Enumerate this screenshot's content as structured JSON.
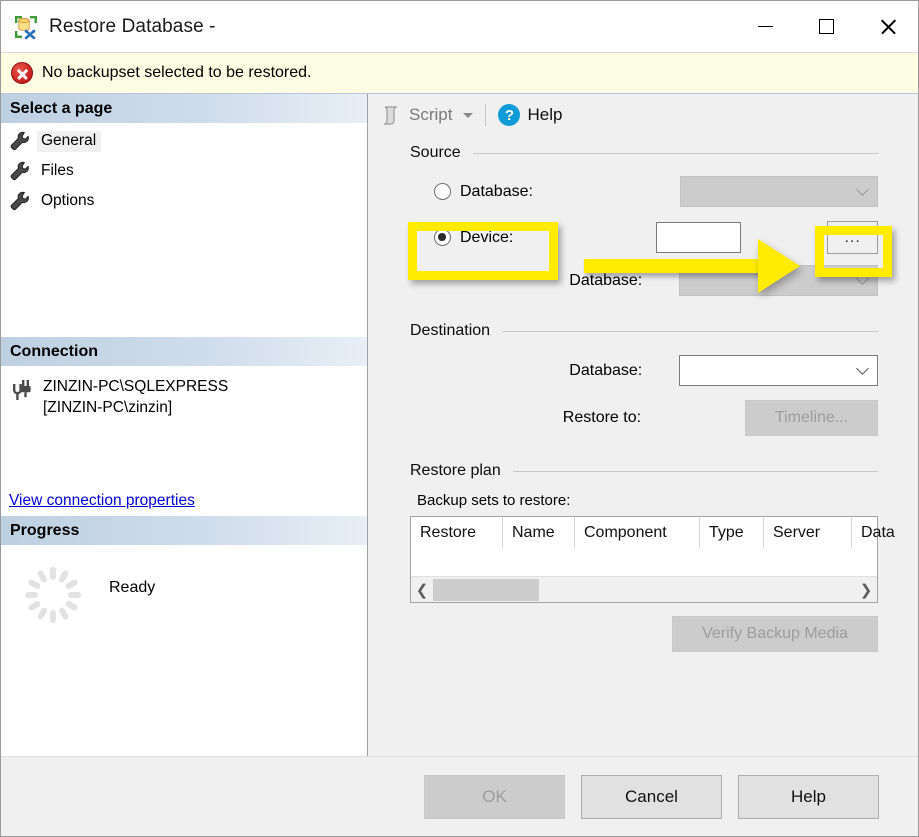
{
  "window": {
    "title": "Restore Database -",
    "icon": "restore-database-icon",
    "minimize_label": "Minimize",
    "maximize_label": "Maximize",
    "close_label": "Close"
  },
  "error_bar": {
    "icon": "error-x-icon",
    "message": "No backupset selected to be restored."
  },
  "left_panel": {
    "pages_header": "Select a page",
    "pages": [
      {
        "label": "General",
        "icon": "wrench-icon",
        "selected": true
      },
      {
        "label": "Files",
        "icon": "wrench-icon",
        "selected": false
      },
      {
        "label": "Options",
        "icon": "wrench-icon",
        "selected": false
      }
    ],
    "connection_header": "Connection",
    "connection_icon": "plug-connection-icon",
    "connection_server": "ZINZIN-PC\\SQLEXPRESS",
    "connection_user": "[ZINZIN-PC\\zinzin]",
    "connection_link": "View connection properties",
    "progress_header": "Progress",
    "progress_icon": "loading-spinner-icon",
    "progress_status": "Ready"
  },
  "toolbar": {
    "script_label": "Script",
    "script_icon": "script-scroll-icon",
    "script_dropdown_icon": "chevron-down-icon",
    "help_label": "Help",
    "help_icon": "help-question-icon"
  },
  "source": {
    "group_title": "Source",
    "database_radio_label": "Database:",
    "database_radio_checked": false,
    "database_combo_value": "",
    "device_radio_label": "Device:",
    "device_radio_checked": true,
    "device_textbox_value": "",
    "browse_button_label": "...",
    "device_database_label": "Database:",
    "device_database_combo_value": ""
  },
  "destination": {
    "group_title": "Destination",
    "database_label": "Database:",
    "database_combo_value": "",
    "restore_to_label": "Restore to:",
    "timeline_button_label": "Timeline..."
  },
  "restore_plan": {
    "group_title": "Restore plan",
    "backup_sets_label": "Backup sets to restore:",
    "columns": [
      "Restore",
      "Name",
      "Component",
      "Type",
      "Server",
      "Data"
    ],
    "rows": [],
    "scroll_left_icon": "chevron-left-icon",
    "scroll_right_icon": "chevron-right-icon",
    "verify_button_label": "Verify Backup Media"
  },
  "footer": {
    "ok_label": "OK",
    "cancel_label": "Cancel",
    "help_label": "Help"
  },
  "annotations": {
    "device_highlight": "yellow-highlight-box",
    "browse_highlight": "yellow-highlight-box",
    "arrow": "yellow-arrow-pointing-right"
  },
  "colors": {
    "highlight": "#ffec00",
    "accent_link": "#0000d8",
    "error": "#c41a1a",
    "help_blue": "#0f9bd7",
    "warning_bg": "#fdfde4"
  }
}
